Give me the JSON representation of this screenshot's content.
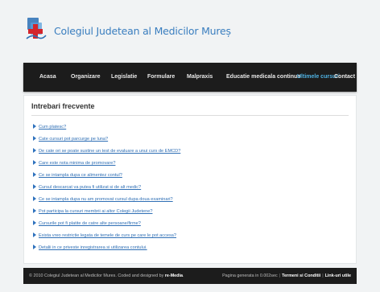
{
  "header": {
    "site_name": "Colegiul Judetean al Medicilor Mureș"
  },
  "nav": {
    "items": [
      {
        "label": "Acasa"
      },
      {
        "label": "Organizare"
      },
      {
        "label": "Legislatie"
      },
      {
        "label": "Formulare"
      },
      {
        "label": "Malpraxis"
      },
      {
        "label": "Educatie medicala continua"
      },
      {
        "label": "Ultimele cursuri"
      },
      {
        "label": "Contact"
      }
    ],
    "active": "Ultimele cursuri",
    "active_color": "#4fb2e3"
  },
  "main": {
    "title": "Intrebari frecvente",
    "faq": [
      "Cum platesc?",
      "Cate cursuri pot parcurge pe luna?",
      "De cate ori se poate sustine un test de evaluare a unui curs de EMCD?",
      "Care este nota minima de promovare?",
      "Ce se intampla dupa ce alimentez contul?",
      "Cursul descarcat va putea fi utilizat si de alt medic?",
      "Ce se intampla dupa nu am promovat cursul dupa doua examinari?",
      "Pot participa la cursuri membrii ai altor Colegii Judetene?",
      "Cursurile pot fi platite de catre alte persoane/firme?",
      "Exista vreo restrictie legata de temele de curs pe care le pot accesa?",
      "Detalii in ce priveste inregistrarea si utilizarea contului."
    ],
    "link_color": "#2f6fb5"
  },
  "footer": {
    "copyright_prefix": "© 2010 Colegiul Judetean al Medicilor Mures. Coded and designed by ",
    "designer": "re-Media",
    "copyright_suffix": ".",
    "generated": "Pagina generata in 0.002sec",
    "terms": "Termeni si Conditii",
    "links": "Link-uri utile"
  },
  "colors": {
    "nav_bg": "#1c1c1c",
    "brand": "#3a7ebf"
  }
}
